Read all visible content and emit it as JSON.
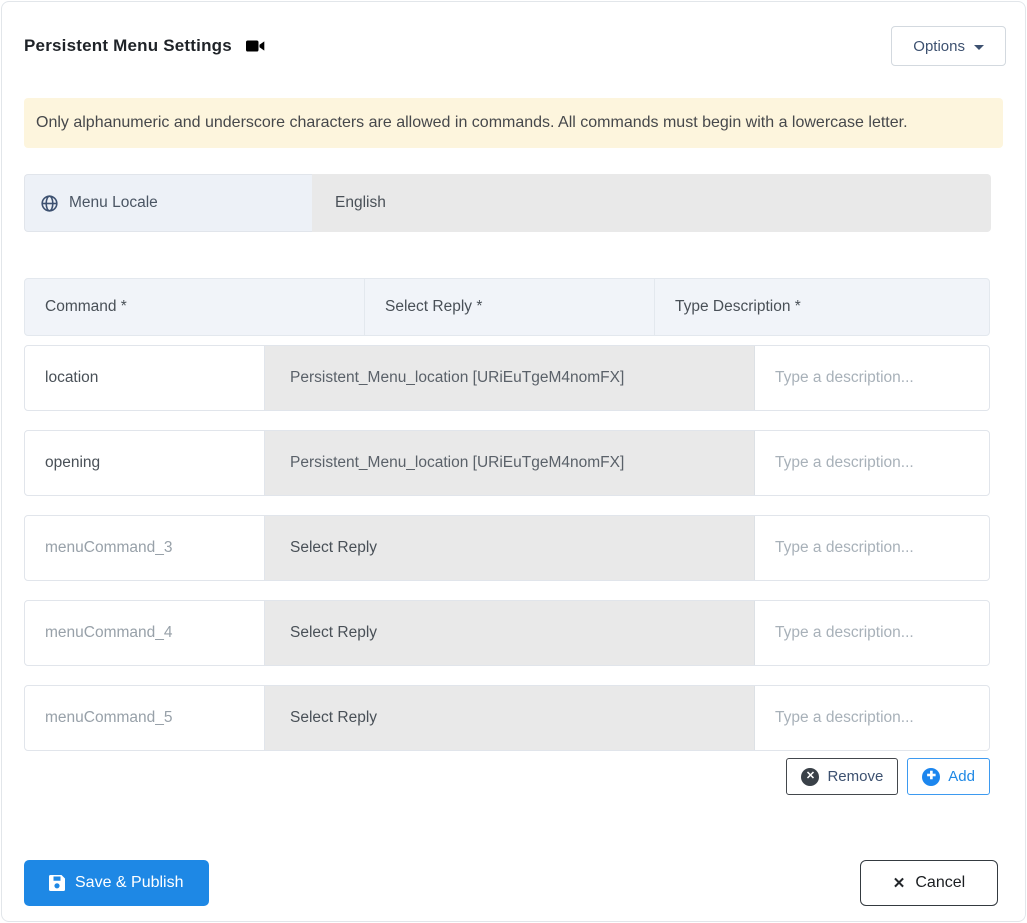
{
  "header": {
    "title": "Persistent Menu Settings",
    "options_label": "Options"
  },
  "notice": "Only alphanumeric and underscore characters are allowed in commands. All commands must begin with a lowercase letter.",
  "locale": {
    "label": "Menu Locale",
    "value": "English"
  },
  "table": {
    "headers": {
      "command": "Command *",
      "reply": "Select Reply *",
      "description": "Type Description *"
    },
    "description_placeholder": "Type a description...",
    "reply_empty_label": "Select Reply",
    "rows": [
      {
        "command": "location",
        "reply": "Persistent_Menu_location [URiEuTgeM4nomFX]"
      },
      {
        "command": "opening",
        "reply": "Persistent_Menu_location [URiEuTgeM4nomFX]"
      },
      {
        "command": "menuCommand_3",
        "reply": "Select Reply"
      },
      {
        "command": "menuCommand_4",
        "reply": "Select Reply"
      },
      {
        "command": "menuCommand_5",
        "reply": "Select Reply"
      }
    ]
  },
  "row_actions": {
    "remove_label": "Remove",
    "add_label": "Add"
  },
  "footer": {
    "save_label": "Save & Publish",
    "cancel_label": "Cancel"
  },
  "icons": {
    "title_icon": "video-camera",
    "locale_icon": "globe",
    "options_icon": "caret-down",
    "remove_icon": "circle-x",
    "add_icon": "circle-plus",
    "save_icon": "floppy-disk",
    "cancel_icon": "x-mark"
  },
  "colors": {
    "primary_blue": "#1e88e5",
    "warning_bg": "#fdf5dd",
    "disabled_field_bg": "#e9e9e9",
    "header_row_bg": "#f1f4f9",
    "locale_label_bg": "#edf1f7",
    "dark_border": "#343a40"
  }
}
